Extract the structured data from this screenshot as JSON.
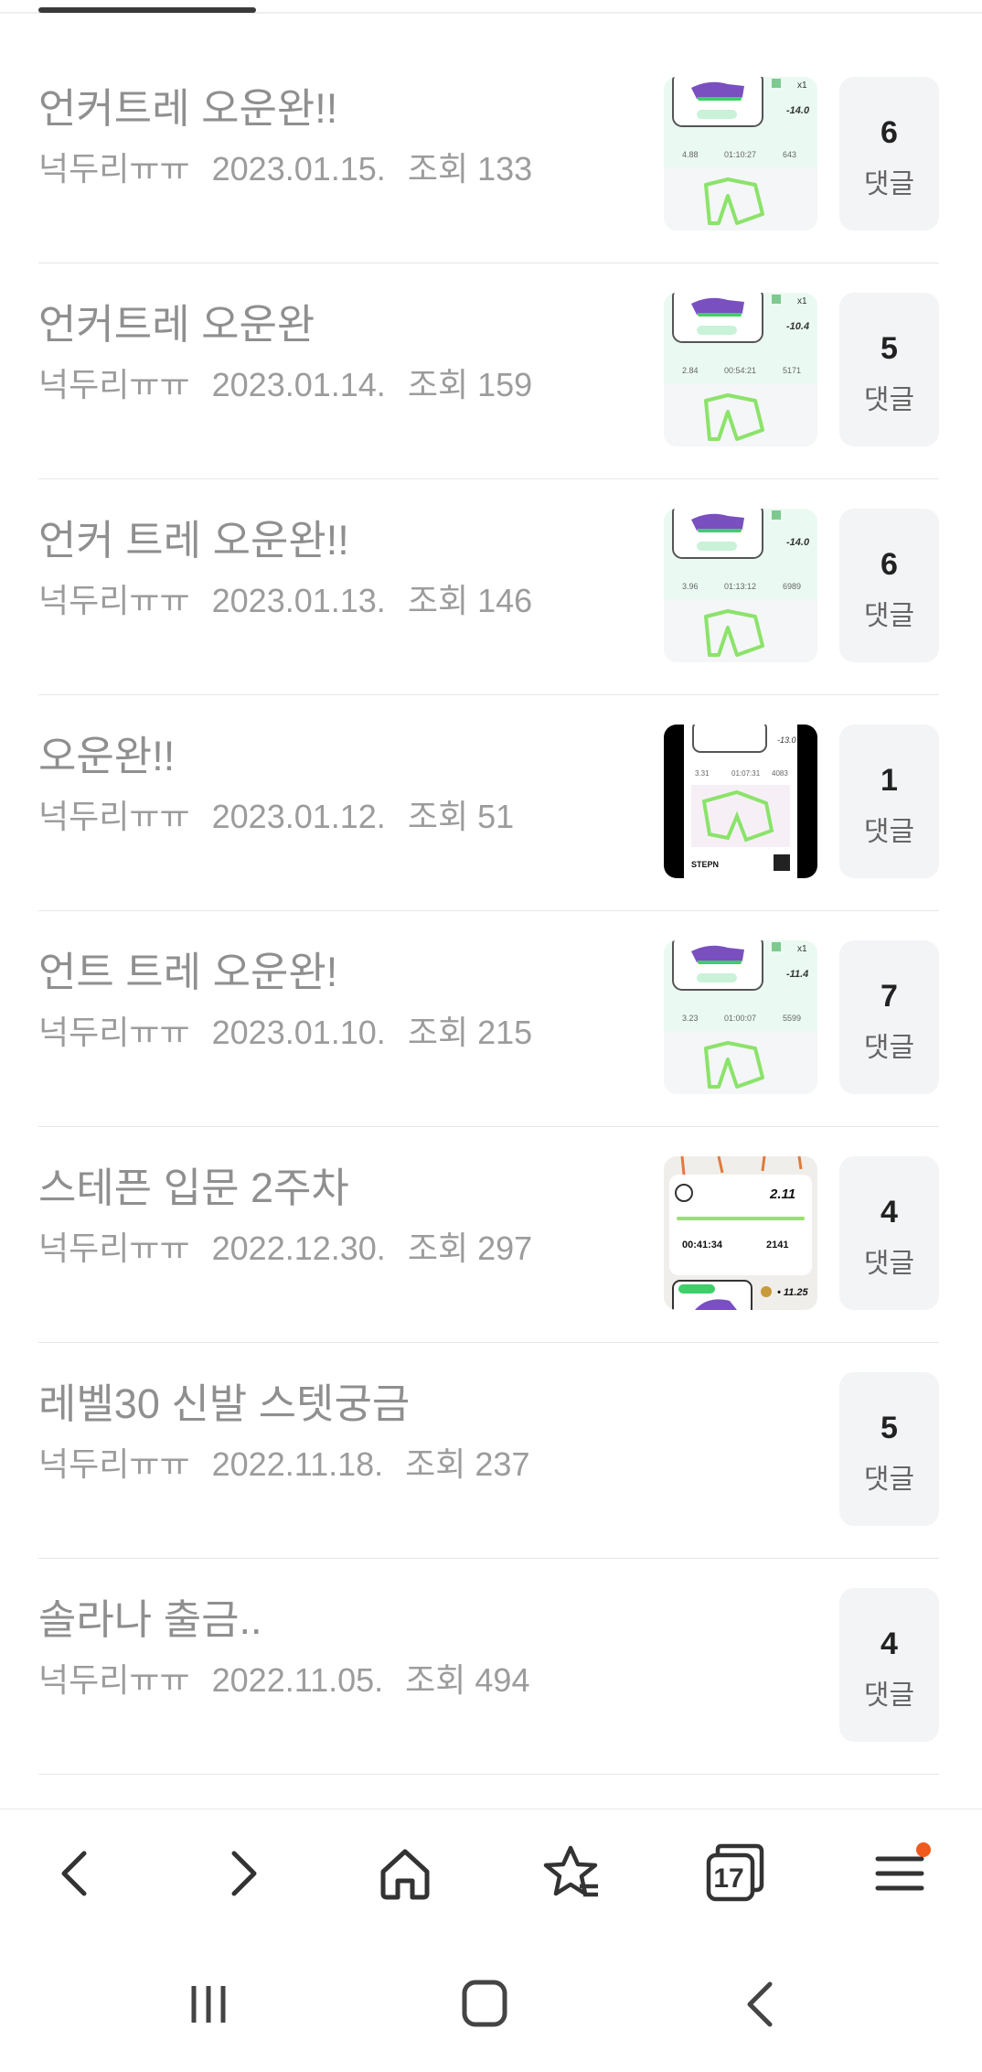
{
  "posts": [
    {
      "title": "언커트레 오운완!!",
      "author": "넉두리ㅠㅠ",
      "date": "2023.01.15.",
      "views": "조회 133",
      "comments": "6",
      "comment_label": "댓글",
      "thumb": "app-green",
      "thumb_text": [
        "x1",
        "-14.0",
        "4.88",
        "01:10:27",
        "643"
      ]
    },
    {
      "title": "언커트레 오운완",
      "author": "넉두리ㅠㅠ",
      "date": "2023.01.14.",
      "views": "조회 159",
      "comments": "5",
      "comment_label": "댓글",
      "thumb": "app-green",
      "thumb_text": [
        "x1",
        "-10.4",
        "2.84",
        "00:54:21",
        "5171"
      ]
    },
    {
      "title": "언커 트레 오운완!!",
      "author": "넉두리ㅠㅠ",
      "date": "2023.01.13.",
      "views": "조회 146",
      "comments": "6",
      "comment_label": "댓글",
      "thumb": "app-green",
      "thumb_text": [
        "",
        "-14.0",
        "3.96",
        "01:13:12",
        "6989"
      ]
    },
    {
      "title": "오운완!!",
      "author": "넉두리ㅠㅠ",
      "date": "2023.01.12.",
      "views": "조회 51",
      "comments": "1",
      "comment_label": "댓글",
      "thumb": "app-dark",
      "thumb_text": [
        "",
        "-13.0",
        "3.31",
        "01:07:31",
        "4083"
      ]
    },
    {
      "title": "언트 트레 오운완!",
      "author": "넉두리ㅠㅠ",
      "date": "2023.01.10.",
      "views": "조회 215",
      "comments": "7",
      "comment_label": "댓글",
      "thumb": "app-green",
      "thumb_text": [
        "x1",
        "-11.4",
        "3.23",
        "01:00:07",
        "5599"
      ]
    },
    {
      "title": "스테픈 입문 2주차",
      "author": "넉두리ㅠㅠ",
      "date": "2022.12.30.",
      "views": "조회 297",
      "comments": "4",
      "comment_label": "댓글",
      "thumb": "app-summary",
      "thumb_text": [
        "2.11",
        "00:41:34",
        "2141",
        "11.25"
      ]
    },
    {
      "title": "레벨30 신발 스텟궁금",
      "author": "넉두리ㅠㅠ",
      "date": "2022.11.18.",
      "views": "조회 237",
      "comments": "5",
      "comment_label": "댓글",
      "thumb": "none",
      "thumb_text": []
    },
    {
      "title": "솔라나 출금..",
      "author": "넉두리ㅠㅠ",
      "date": "2022.11.05.",
      "views": "조회 494",
      "comments": "4",
      "comment_label": "댓글",
      "thumb": "none",
      "thumb_text": []
    }
  ],
  "nav": {
    "icons": [
      "back-icon",
      "forward-icon",
      "home-icon",
      "bookmarks-icon",
      "tabs-icon",
      "menu-icon"
    ],
    "tab_count": "17",
    "accent": "#f05a1c"
  },
  "system": {
    "icons": [
      "recent-apps-icon",
      "home-circle-icon",
      "system-back-icon"
    ]
  }
}
